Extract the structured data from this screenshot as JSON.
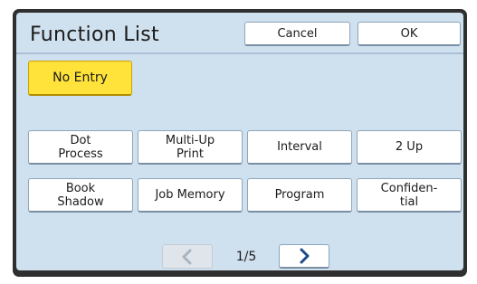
{
  "header": {
    "title": "Function List",
    "cancel_label": "Cancel",
    "ok_label": "OK"
  },
  "no_entry_label": "No Entry",
  "functions": [
    "Dot\nProcess",
    "Multi-Up\nPrint",
    "Interval",
    "2 Up",
    "Book\nShadow",
    "Job Memory",
    "Program",
    "Confiden-\ntial"
  ],
  "pager": {
    "indicator": "1/5",
    "prev_icon": "chevron-left-icon",
    "next_icon": "chevron-right-icon"
  },
  "colors": {
    "screen_bg": "#cfe0ee",
    "highlight": "#ffe23a",
    "frame": "#2f2f2f",
    "chevron_active": "#1f4a8a",
    "chevron_disabled": "#a9b4bf"
  }
}
